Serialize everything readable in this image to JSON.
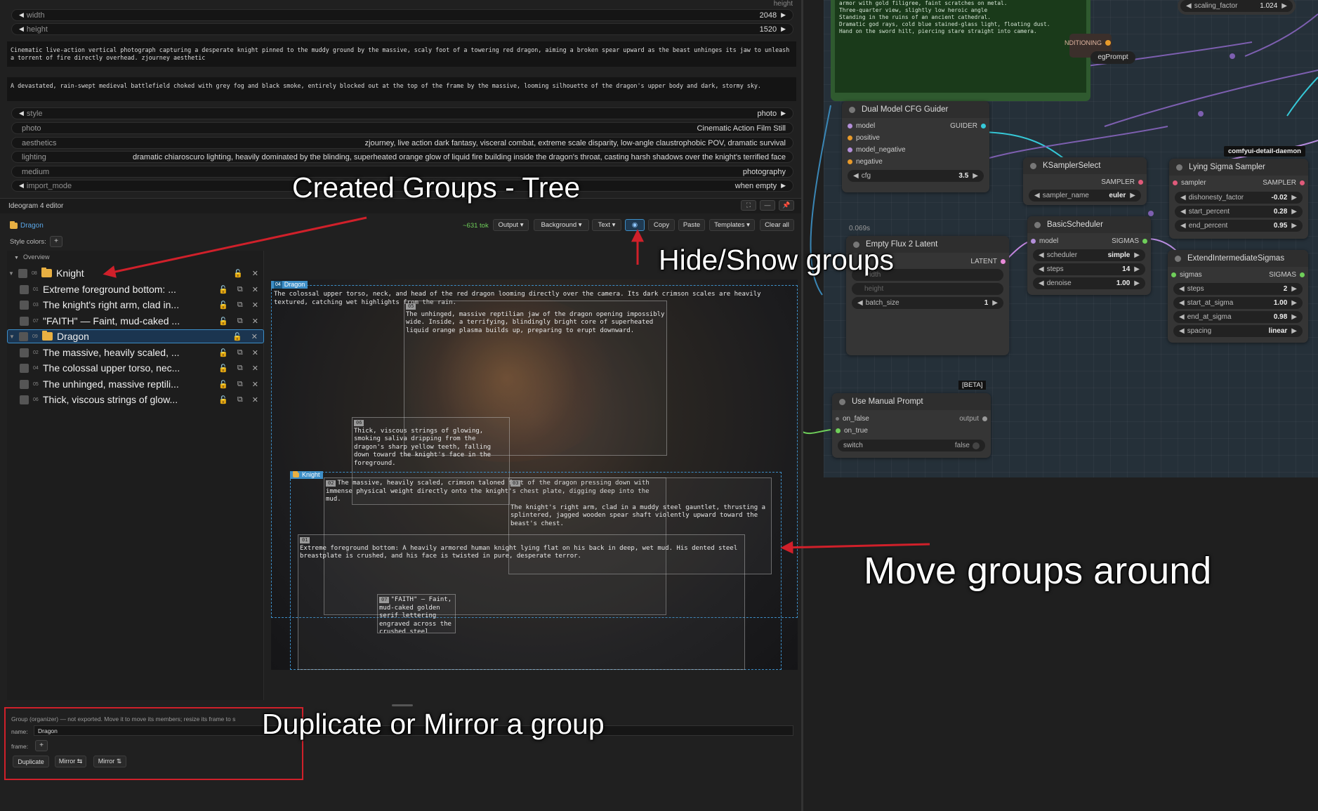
{
  "top_widgets": {
    "height_label": "height",
    "width": {
      "name": "width",
      "value": "2048"
    },
    "height": {
      "name": "height",
      "value": "1520"
    },
    "prompt1": "Cinematic live-action vertical photograph capturing a desperate knight pinned to the muddy ground by the massive, scaly foot of a towering red dragon, aiming a broken spear upward as the beast unhinges its jaw to unleash a torrent of fire directly overhead. zjourney aesthetic",
    "prompt2": "A devastated, rain-swept medieval battlefield choked with grey fog and black smoke, entirely blocked out at the top of the frame by the massive, looming silhouette of the dragon's upper body and dark, stormy sky.",
    "style": {
      "name": "style",
      "value": "photo"
    },
    "rows": [
      {
        "name": "photo",
        "value": "Cinematic Action Film Still"
      },
      {
        "name": "aesthetics",
        "value": "zjourney, live action dark fantasy, visceral combat, extreme scale disparity, low-angle claustrophobic POV, dramatic survival"
      },
      {
        "name": "lighting",
        "value": "dramatic chiaroscuro lighting, heavily dominated by the blinding, superheated orange glow of liquid fire building inside the dragon's throat, casting harsh shadows over the knight's terrified face"
      },
      {
        "name": "medium",
        "value": "photography"
      }
    ],
    "import_mode": {
      "name": "import_mode",
      "value": "when empty"
    }
  },
  "editor": {
    "title": "Ideogram 4 editor",
    "breadcrumb": "Dragon",
    "style_colors_label": "Style colors:",
    "plus": "+",
    "tokens": "~631 tok",
    "toolbar": {
      "output": "Output ▾",
      "background": "Background ▾",
      "text": "Text ▾",
      "copy": "Copy",
      "paste": "Paste",
      "templates": "Templates ▾",
      "clear_all": "Clear all"
    },
    "overview": "Overview",
    "tree": [
      {
        "num": "08",
        "label": "Knight",
        "group": true
      },
      {
        "num": "01",
        "label": "Extreme foreground bottom: ...",
        "group": false
      },
      {
        "num": "03",
        "label": "The knight's right arm, clad in...",
        "group": false
      },
      {
        "num": "07",
        "label": "\"FAITH\" — Faint, mud-caked ...",
        "group": false
      },
      {
        "num": "09",
        "label": "Dragon",
        "group": true
      },
      {
        "num": "02",
        "label": "The massive, heavily scaled, ...",
        "group": false
      },
      {
        "num": "04",
        "label": "The colossal upper torso, nec...",
        "group": false
      },
      {
        "num": "05",
        "label": "The unhinged, massive reptili...",
        "group": false
      },
      {
        "num": "06",
        "label": "Thick, viscous strings of glow...",
        "group": false
      }
    ],
    "regions": {
      "r04": "The colossal upper torso, neck, and head of the red dragon looming directly over the camera. Its dark crimson scales are heavily textured, catching wet highlights from the rain.",
      "r05": "The unhinged, massive reptilian jaw of the dragon opening impossibly wide. Inside, a terrifying, blindingly bright core of superheated liquid orange plasma builds up, preparing to erupt downward.",
      "r06": "Thick, viscous strings of glowing, smoking saliva dripping from the dragon's sharp yellow teeth, falling down toward the knight's face in the foreground.",
      "r02": "The massive, heavily scaled, crimson taloned foot of the dragon pressing down with immense physical weight directly onto the knight's chest plate, digging deep into the mud.",
      "r03": "The knight's right arm, clad in a muddy steel gauntlet, thrusting a splintered, jagged wooden spear shaft violently upward toward the beast's chest.",
      "r01": "Extreme foreground bottom: A heavily armored human knight lying flat on his back in deep, wet mud. His dented steel breastplate is crushed, and his face is twisted in pure, desperate terror.",
      "r07": "\"FAITH\" — Faint, mud-caked golden serif lettering engraved across the crushed steel",
      "n04": "04",
      "n05": "05",
      "n06": "06",
      "n02": "02",
      "n03": "03",
      "n01": "01",
      "n07": "07",
      "g_dragon": "Dragon",
      "g_dragon_n": "04",
      "g_knight": "Knight"
    },
    "group_panel": {
      "info": "Group (organizer) — not exported. Move it to move its members; resize its frame to s",
      "name_label": "name:",
      "name_value": "Dragon",
      "frame_label": "frame:",
      "frame_btn": "+",
      "duplicate": "Duplicate",
      "mirror_h": "Mirror ⇆",
      "mirror_v": "Mirror ⇅"
    }
  },
  "nodes": {
    "note_text": "armor with gold filigree, faint scratches on metal.\nThree-quarter view, slightly low heroic angle\nStanding in the ruins of an ancient cathedral.\nDramatic god rays, cold blue stained-glass light, floating dust.\nHand on the sword hilt, piercing stare straight into camera.",
    "scaling": {
      "name": "scaling_factor",
      "value": "1.024"
    },
    "conditioning": "NDITIONING",
    "negprompt": "egPrompt",
    "cfg_guider": {
      "title": "Dual Model CFG Guider",
      "in": [
        "model",
        "positive",
        "model_negative",
        "negative"
      ],
      "out": "GUIDER",
      "cfg": {
        "name": "cfg",
        "value": "3.5"
      }
    },
    "timing": "0.069s",
    "ksampler": {
      "title": "KSamplerSelect",
      "out": "SAMPLER",
      "w": {
        "name": "sampler_name",
        "value": "euler"
      }
    },
    "lying": {
      "badge": "comfyui-detail-daemon",
      "title": "Lying Sigma Sampler",
      "in": "sampler",
      "out": "SAMPLER",
      "w": [
        {
          "name": "dishonesty_factor",
          "value": "-0.02"
        },
        {
          "name": "start_percent",
          "value": "0.28"
        },
        {
          "name": "end_percent",
          "value": "0.95"
        }
      ]
    },
    "latent": {
      "title": "Empty Flux 2 Latent",
      "out": "LATENT",
      "w": [
        {
          "name": "width",
          "value": ""
        },
        {
          "name": "height",
          "value": ""
        },
        {
          "name": "batch_size",
          "value": "1"
        }
      ]
    },
    "basic": {
      "title": "BasicScheduler",
      "in": "model",
      "out": "SIGMAS",
      "w": [
        {
          "name": "scheduler",
          "value": "simple"
        },
        {
          "name": "steps",
          "value": "14"
        },
        {
          "name": "denoise",
          "value": "1.00"
        }
      ]
    },
    "extend": {
      "title": "ExtendIntermediateSigmas",
      "in": "sigmas",
      "out": "SIGMAS",
      "w": [
        {
          "name": "steps",
          "value": "2"
        },
        {
          "name": "start_at_sigma",
          "value": "1.00"
        },
        {
          "name": "end_at_sigma",
          "value": "0.98"
        },
        {
          "name": "spacing",
          "value": "linear"
        }
      ]
    },
    "manual": {
      "beta": "[BETA]",
      "title": "Use Manual Prompt",
      "in1": "on_false",
      "in2": "on_true",
      "out": "output",
      "w": {
        "name": "switch",
        "value": "false"
      }
    }
  },
  "annotations": {
    "tree": "Created Groups - Tree",
    "hide": "Hide/Show groups",
    "move": "Move groups around",
    "dup": "Duplicate or Mirror a group"
  },
  "colors": {
    "accent_red": "#d0202a",
    "group_blue": "#3d8ec7",
    "folder": "#e8b042",
    "link_cyan": "#36c9d8",
    "link_purple": "#b88ce0",
    "link_orange": "#e89a2a"
  }
}
